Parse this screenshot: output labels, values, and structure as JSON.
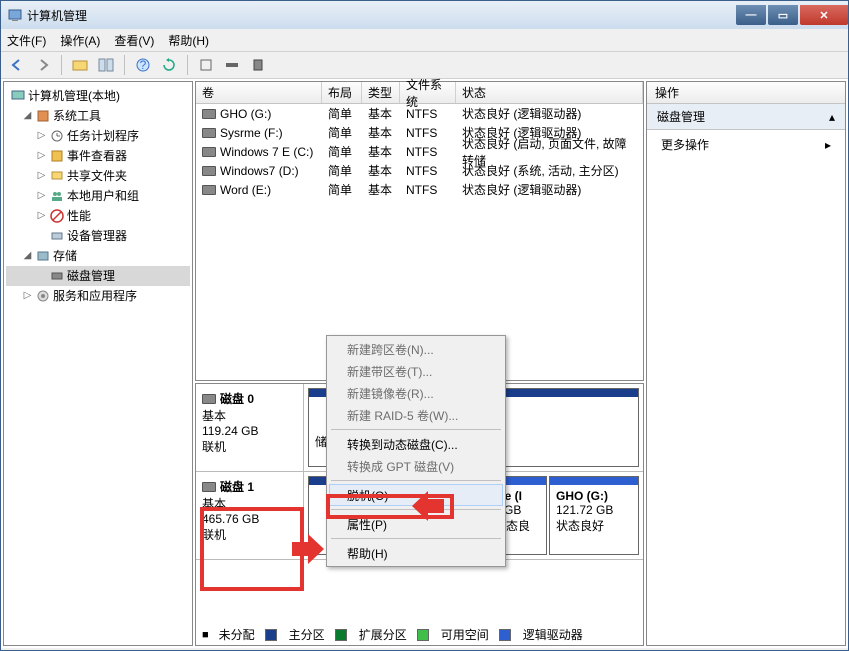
{
  "window": {
    "title": "计算机管理"
  },
  "menubar": {
    "file": "文件(F)",
    "action": "操作(A)",
    "view": "查看(V)",
    "help": "帮助(H)"
  },
  "tree": {
    "root": "计算机管理(本地)",
    "systools": "系统工具",
    "task": "任务计划程序",
    "event": "事件查看器",
    "share": "共享文件夹",
    "users": "本地用户和组",
    "perf": "性能",
    "devmgr": "设备管理器",
    "storage": "存储",
    "diskmgmt": "磁盘管理",
    "services": "服务和应用程序"
  },
  "columns": {
    "vol": "卷",
    "layout": "布局",
    "type": "类型",
    "fs": "文件系统",
    "status": "状态"
  },
  "volumes": [
    {
      "name": "GHO (G:)",
      "layout": "简单",
      "type": "基本",
      "fs": "NTFS",
      "status": "状态良好 (逻辑驱动器)"
    },
    {
      "name": "Sysrme (F:)",
      "layout": "简单",
      "type": "基本",
      "fs": "NTFS",
      "status": "状态良好 (逻辑驱动器)"
    },
    {
      "name": "Windows 7 E (C:)",
      "layout": "简单",
      "type": "基本",
      "fs": "NTFS",
      "status": "状态良好 (启动, 页面文件, 故障转储"
    },
    {
      "name": "Windows7 (D:)",
      "layout": "简单",
      "type": "基本",
      "fs": "NTFS",
      "status": "状态良好 (系统, 活动, 主分区)"
    },
    {
      "name": "Word (E:)",
      "layout": "简单",
      "type": "基本",
      "fs": "NTFS",
      "status": "状态良好 (逻辑驱动器)"
    }
  ],
  "disk0": {
    "name": "磁盘 0",
    "type": "基本",
    "size": "119.24 GB",
    "state": "联机",
    "p1": {
      "status": "储, 主分区)"
    }
  },
  "disk1": {
    "name": "磁盘 1",
    "type": "基本",
    "size": "465.76 GB",
    "state": "联机",
    "p1": {
      "name": "me (I",
      "size": "1 GB",
      "status": "状态良好"
    },
    "p2": {
      "name": "GHO (G:)",
      "size": "121.72 GB",
      "status": "状态良好"
    }
  },
  "legend": {
    "unalloc": "未分配",
    "primary": "主分区",
    "extended": "扩展分区",
    "free": "可用空间",
    "logical": "逻辑驱动器"
  },
  "actions": {
    "header": "操作",
    "diskmgmt": "磁盘管理",
    "more": "更多操作"
  },
  "ctx": {
    "span": "新建跨区卷(N)...",
    "stripe": "新建带区卷(T)...",
    "mirror": "新建镜像卷(R)...",
    "raid5": "新建 RAID-5 卷(W)...",
    "dynamic": "转换到动态磁盘(C)...",
    "gpt": "转换成 GPT 磁盘(V)",
    "offline": "脱机(O)",
    "prop": "属性(P)",
    "help": "帮助(H)"
  },
  "colors": {
    "primary": "#1a3e8c",
    "logical": "#2e5fd0",
    "extended": "#0a7a2f",
    "free": "#3fbf4a",
    "unalloc": "#000"
  }
}
